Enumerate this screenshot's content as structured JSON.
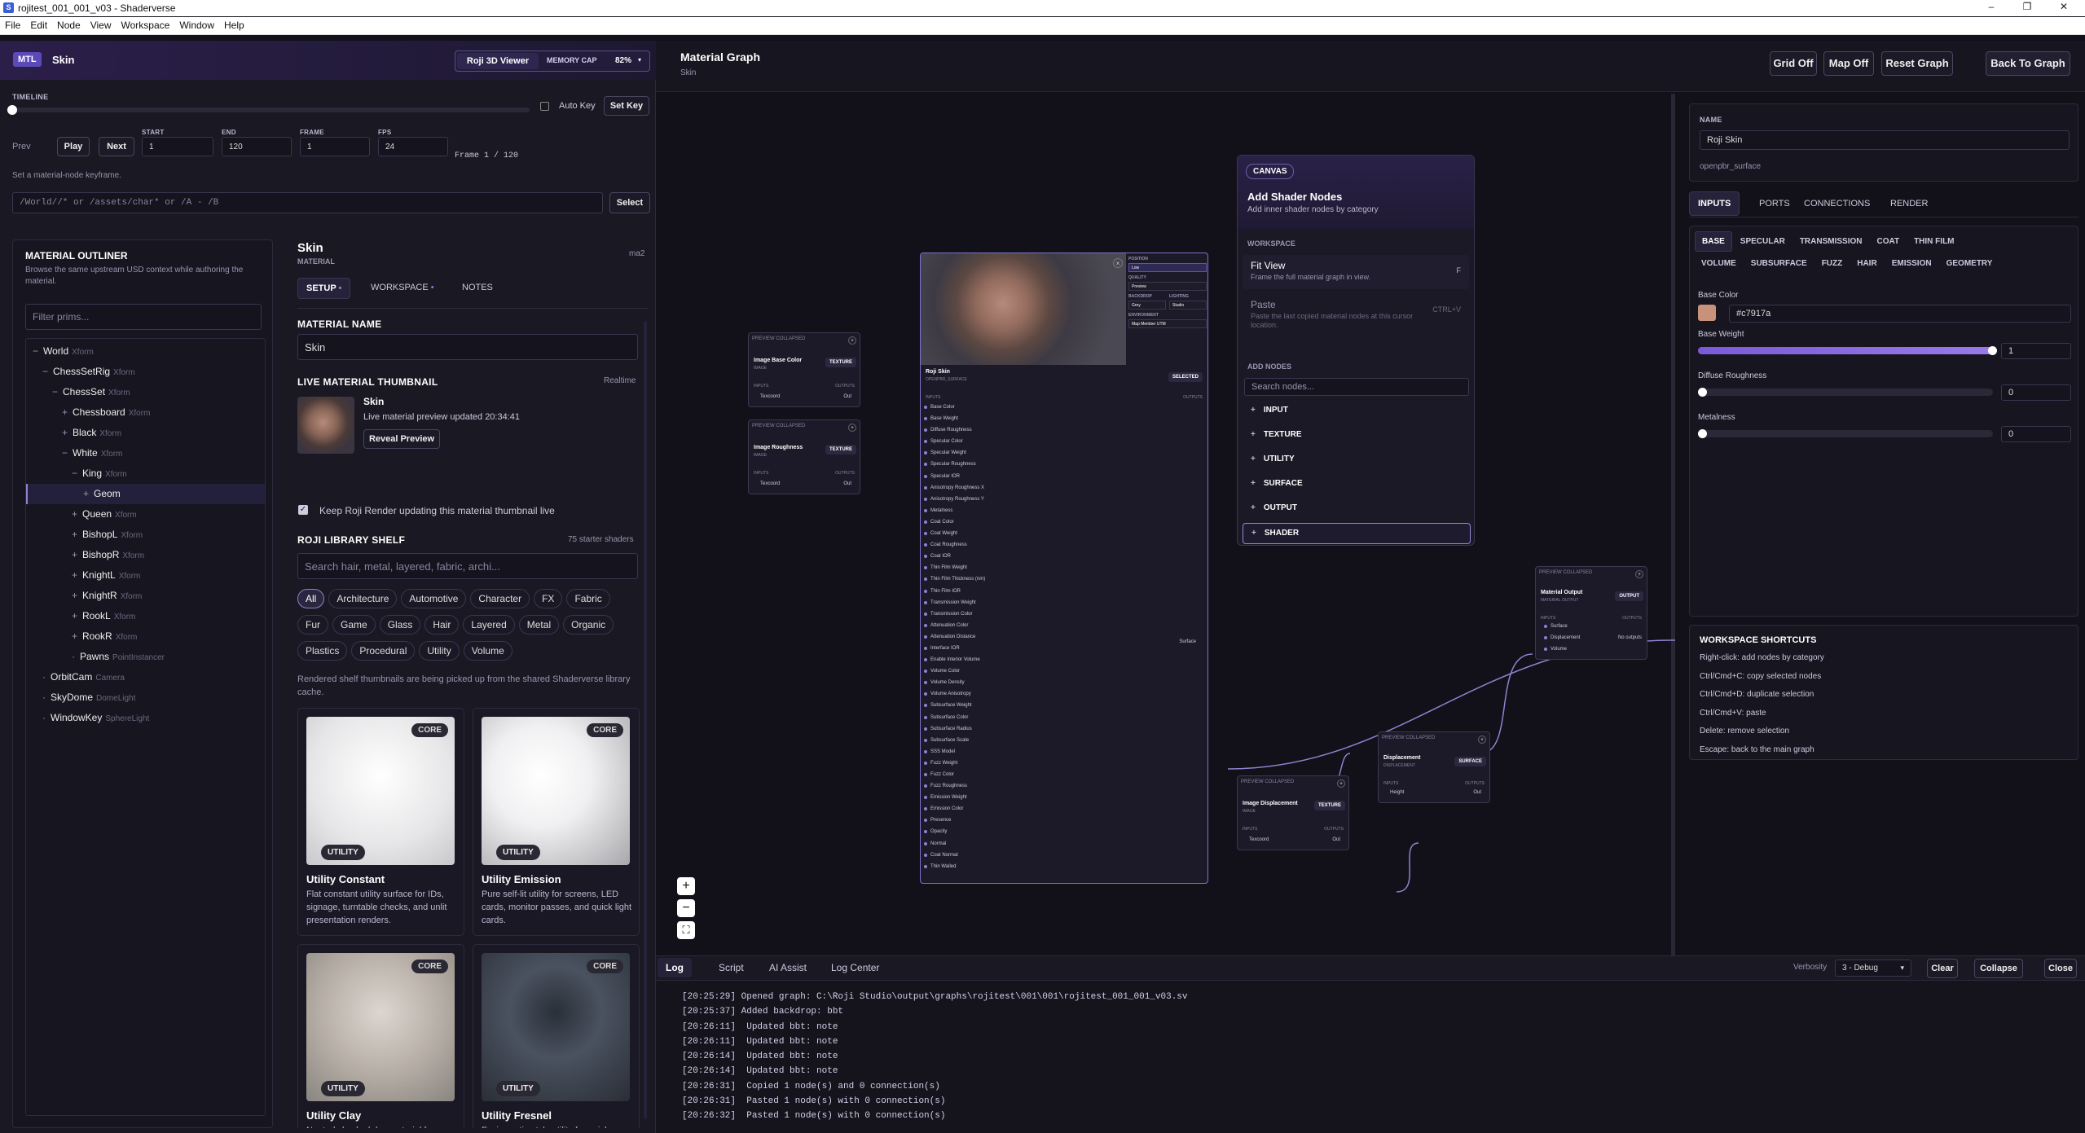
{
  "window": {
    "title": "rojitest_001_001_v03 - Shaderverse",
    "minimize": "–",
    "maximize": "❐",
    "close": "✕",
    "app_icon": "S"
  },
  "menu": [
    "File",
    "Edit",
    "Node",
    "View",
    "Workspace",
    "Window",
    "Help"
  ],
  "header": {
    "badge": "MTL",
    "material": "Skin",
    "viewer_btn": "Roji 3D Viewer",
    "memory_label": "MEMORY CAP",
    "memory_value": "82%"
  },
  "timeline": {
    "label": "TIMELINE",
    "auto_key": "Auto Key",
    "set_key": "Set Key",
    "prev": "Prev",
    "play": "Play",
    "next": "Next",
    "start_label": "START",
    "start": "1",
    "end_label": "END",
    "end": "120",
    "frame_label": "FRAME",
    "frame": "1",
    "fps_label": "FPS",
    "fps": "24",
    "frame_readout": "Frame 1 / 120",
    "hint": "Set a material-node keyframe.",
    "progress": 0.0
  },
  "select": {
    "value": "/World//*  or  /assets/char*  or  /A - /B",
    "button": "Select"
  },
  "outliner": {
    "title": "MATERIAL OUTLINER",
    "desc": "Browse the same upstream USD context while authoring the material.",
    "filter_placeholder": "Filter prims...",
    "items": [
      {
        "label": "World",
        "type": "Xform",
        "indent": 0,
        "prefix": "−"
      },
      {
        "label": "ChessSetRig",
        "type": "Xform",
        "indent": 1,
        "prefix": "−"
      },
      {
        "label": "ChessSet",
        "type": "Xform",
        "indent": 2,
        "prefix": "−"
      },
      {
        "label": "Chessboard",
        "type": "Xform",
        "indent": 3,
        "prefix": "+"
      },
      {
        "label": "Black",
        "type": "Xform",
        "indent": 3,
        "prefix": "+"
      },
      {
        "label": "White",
        "type": "Xform",
        "indent": 3,
        "prefix": "−"
      },
      {
        "label": "King",
        "type": "Xform",
        "indent": 4,
        "prefix": "−"
      },
      {
        "label": "Geom",
        "type": "",
        "indent": 5,
        "prefix": "+",
        "selected": true
      },
      {
        "label": "Queen",
        "type": "Xform",
        "indent": 4,
        "prefix": "+"
      },
      {
        "label": "BishopL",
        "type": "Xform",
        "indent": 4,
        "prefix": "+"
      },
      {
        "label": "BishopR",
        "type": "Xform",
        "indent": 4,
        "prefix": "+"
      },
      {
        "label": "KnightL",
        "type": "Xform",
        "indent": 4,
        "prefix": "+"
      },
      {
        "label": "KnightR",
        "type": "Xform",
        "indent": 4,
        "prefix": "+"
      },
      {
        "label": "RookL",
        "type": "Xform",
        "indent": 4,
        "prefix": "+"
      },
      {
        "label": "RookR",
        "type": "Xform",
        "indent": 4,
        "prefix": "+"
      },
      {
        "label": "Pawns",
        "type": "PointInstancer",
        "indent": 4,
        "prefix": "·"
      },
      {
        "label": "OrbitCam",
        "type": "Camera",
        "indent": 1,
        "prefix": "·"
      },
      {
        "label": "SkyDome",
        "type": "DomeLight",
        "indent": 1,
        "prefix": "·"
      },
      {
        "label": "WindowKey",
        "type": "SphereLight",
        "indent": 1,
        "prefix": "·"
      }
    ]
  },
  "material": {
    "title": "Skin",
    "subtitle": "MATERIAL",
    "id": "ma2",
    "tabs": [
      "SETUP",
      "WORKSPACE",
      "NOTES"
    ],
    "name_label": "MATERIAL NAME",
    "name_value": "Skin",
    "thumb_label": "LIVE MATERIAL THUMBNAIL",
    "thumb_mode": "Realtime",
    "thumb_name": "Skin",
    "thumb_status": "Live material preview updated 20:34:41",
    "reveal": "Reveal Preview",
    "keep_live": "Keep Roji Render updating this material thumbnail live",
    "shelf_label": "ROJI LIBRARY SHELF",
    "shelf_count": "75 starter shaders",
    "shelf_placeholder": "Search hair, metal, layered, fabric, archi...",
    "chips": [
      "All",
      "Architecture",
      "Automotive",
      "Character",
      "FX",
      "Fabric",
      "Fur",
      "Game",
      "Glass",
      "Hair",
      "Layered",
      "Metal",
      "Organic",
      "Plastics",
      "Procedural",
      "Utility",
      "Volume"
    ],
    "shelf_note": "Rendered shelf thumbnails are being picked up from the shared Shaderverse library cache.",
    "cards": [
      {
        "badge": "UTILITY",
        "core": "CORE",
        "title": "Utility Constant",
        "desc": "Flat constant utility surface for IDs, signage, turntable checks, and unlit presentation renders."
      },
      {
        "badge": "UTILITY",
        "core": "CORE",
        "title": "Utility Emission",
        "desc": "Pure self-lit utility for screens, LED cards, monitor passes, and quick light cards."
      },
      {
        "badge": "UTILITY",
        "core": "CORE",
        "title": "Utility Clay",
        "desc": "Neutral clay lookdev material for reading form, silhouette, and lighting without texture distraction."
      },
      {
        "badge": "UTILITY",
        "core": "CORE",
        "title": "Utility Fresnel",
        "desc": "Facing-ratio style utility for quick grazing-angle reads and stylized rim diagnostics."
      }
    ]
  },
  "graph": {
    "title": "Material Graph",
    "subtitle": "Skin",
    "buttons": [
      "Grid Off",
      "Map Off",
      "Reset Graph",
      "Back To Graph"
    ]
  },
  "nodes": {
    "collapsed": "PREVIEW COLLAPSED",
    "inputs": "INPUTS",
    "outputs": "OUTPUTS",
    "texcoord": "Texcoord",
    "out": "Out",
    "basecolor": {
      "name": "Image Base Color",
      "sub": "IMAGE",
      "tag": "TEXTURE"
    },
    "roughness": {
      "name": "Image Roughness",
      "sub": "IMAGE",
      "tag": "TEXTURE"
    },
    "imgdisp": {
      "name": "Image Displacement",
      "sub": "IMAGE",
      "tag": "TEXTURE"
    },
    "disp": {
      "name": "Displacement",
      "sub": "DISPLACEMENT",
      "tag": "SURFACE",
      "port": "Height"
    },
    "output": {
      "name": "Material Output",
      "sub": "MATERIAL OUTPUT",
      "tag": "OUTPUT",
      "ports": [
        "Surface",
        "Displacement",
        "Volume"
      ],
      "no_outputs": "No outputs"
    },
    "roji": {
      "name": "Roji Skin",
      "sub": "OPENPBR_SURFACE",
      "selected": "SELECTED",
      "surface_out": "Surface",
      "controls": {
        "position_label": "POSITION",
        "position": "Low",
        "quality_label": "QUALITY",
        "quality": "Preview",
        "backdrop_label": "BACKDROP",
        "backdrop": "Grey",
        "lighting_label": "LIGHTING",
        "lighting": "Studio",
        "env_label": "ENVIRONMENT",
        "env": "Map Member UTM"
      },
      "ports": [
        "Base Color",
        "Base Weight",
        "Diffuse Roughness",
        "Specular Color",
        "Specular Weight",
        "Specular Roughness",
        "Specular IOR",
        "Anisotropy Roughness X",
        "Anisotropy Roughness Y",
        "Metalness",
        "Coat Color",
        "Coat Weight",
        "Coat Roughness",
        "Coat IOR",
        "Thin Film Weight",
        "Thin Film Thickness (nm)",
        "Thin Film IOR",
        "Transmission Weight",
        "Transmission Color",
        "Attenuation Color",
        "Attenuation Distance",
        "Interface IOR",
        "Enable Interior Volume",
        "Volume Color",
        "Volume Density",
        "Volume Anisotropy",
        "Subsurface Weight",
        "Subsurface Color",
        "Subsurface Radius",
        "Subsurface Scale",
        "SSS Model",
        "Fuzz Weight",
        "Fuzz Color",
        "Fuzz Roughness",
        "Emission Weight",
        "Emission Color",
        "Presence",
        "Opacity",
        "Normal",
        "Coat Normal",
        "Thin Walled"
      ]
    }
  },
  "menu_popup": {
    "canvas": "CANVAS",
    "title": "Add Shader Nodes",
    "desc": "Add inner shader nodes by category",
    "workspace_label": "WORKSPACE",
    "fit_view": "Fit View",
    "fit_desc": "Frame the full material graph in view.",
    "fit_key": "F",
    "paste": "Paste",
    "paste_desc": "Paste the last copied material nodes at this cursor location.",
    "paste_key": "CTRL+V",
    "add_label": "ADD NODES",
    "search_placeholder": "Search nodes...",
    "categories": [
      "INPUT",
      "TEXTURE",
      "UTILITY",
      "SURFACE",
      "OUTPUT",
      "SHADER"
    ]
  },
  "zoom": {
    "plus": "+",
    "minus": "−",
    "fit": "⛶"
  },
  "inspector": {
    "name_label": "NAME",
    "name": "Roji Skin",
    "type": "openpbr_surface",
    "tabs": [
      "INPUTS",
      "PORTS",
      "CONNECTIONS",
      "RENDER"
    ],
    "subtabs": [
      "BASE",
      "SPECULAR",
      "TRANSMISSION",
      "COAT",
      "THIN FILM",
      "VOLUME",
      "SUBSURFACE",
      "FUZZ",
      "HAIR",
      "EMISSION",
      "GEOMETRY"
    ],
    "base_color_label": "Base Color",
    "base_color_hex": "#c7917a",
    "base_color": "#c7917a",
    "sliders": [
      {
        "label": "Base Weight",
        "value": "1",
        "fraction": 1.0
      },
      {
        "label": "Diffuse Roughness",
        "value": "0",
        "fraction": 0.0
      },
      {
        "label": "Metalness",
        "value": "0",
        "fraction": 0.0
      }
    ],
    "shortcuts_title": "WORKSPACE SHORTCUTS",
    "shortcuts": [
      "Right-click: add nodes by category",
      "Ctrl/Cmd+C: copy selected nodes",
      "Ctrl/Cmd+D: duplicate selection",
      "Ctrl/Cmd+V: paste",
      "Delete: remove selection",
      "Escape: back to the main graph"
    ]
  },
  "log": {
    "tabs": [
      "Log",
      "Script",
      "AI Assist",
      "Log Center"
    ],
    "verbosity_label": "Verbosity",
    "verbosity": "3 - Debug",
    "clear": "Clear",
    "collapse": "Collapse",
    "close": "Close",
    "lines": [
      "[20:25:29] Opened graph: C:\\Roji Studio\\output\\graphs\\rojitest\\001\\001\\rojitest_001_001_v03.sv",
      "[20:25:37] Added backdrop: bbt",
      "[20:26:11]  Updated bbt: note",
      "[20:26:11]  Updated bbt: note",
      "[20:26:14]  Updated bbt: note",
      "[20:26:14]  Updated bbt: note",
      "[20:26:31]  Copied 1 node(s) and 0 connection(s)",
      "[20:26:31]  Pasted 1 node(s) with 0 connection(s)",
      "[20:26:32]  Pasted 1 node(s) with 0 connection(s)"
    ]
  }
}
